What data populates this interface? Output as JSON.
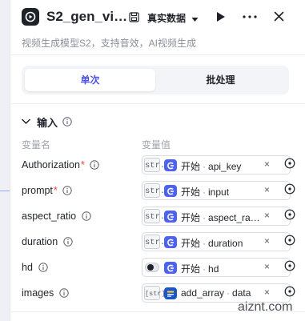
{
  "header": {
    "title": "S2_gen_vi…",
    "data_source": "真实数据",
    "subtitle": "视频生成模型S2，支持音效，AI视频生成",
    "icons": [
      "app-logo-icon",
      "save-icon",
      "chevron-down-icon",
      "play-icon",
      "more-icon",
      "close-icon"
    ]
  },
  "tabs": [
    {
      "label": "单次",
      "active": true
    },
    {
      "label": "批处理",
      "active": false
    }
  ],
  "section": {
    "title": "输入",
    "col_name": "变量名",
    "col_value": "变量值"
  },
  "inputs": [
    {
      "name": "Authorization",
      "required": "*",
      "type": "str.",
      "node": "开始",
      "sep": "·",
      "var": "api_key"
    },
    {
      "name": "prompt",
      "required": "*",
      "type": "str.",
      "node": "开始",
      "sep": "·",
      "var": "input"
    },
    {
      "name": "aspect_ratio",
      "required": "",
      "type": "str.",
      "node": "开始",
      "sep": "·",
      "var": "aspect_ra…"
    },
    {
      "name": "duration",
      "required": "",
      "type": "str.",
      "node": "开始",
      "sep": "·",
      "var": "duration"
    },
    {
      "name": "hd",
      "required": "",
      "type": "toggle",
      "node": "开始",
      "sep": "·",
      "var": "hd"
    },
    {
      "name": "images",
      "required": "",
      "type": "[str]",
      "node": "add_array",
      "sep": "·",
      "var": "data"
    }
  ],
  "watermark": "aiznt.com",
  "colors": {
    "accent": "#4d53e8",
    "required": "#f53f3f",
    "ref_icon": "#4e62f0"
  }
}
